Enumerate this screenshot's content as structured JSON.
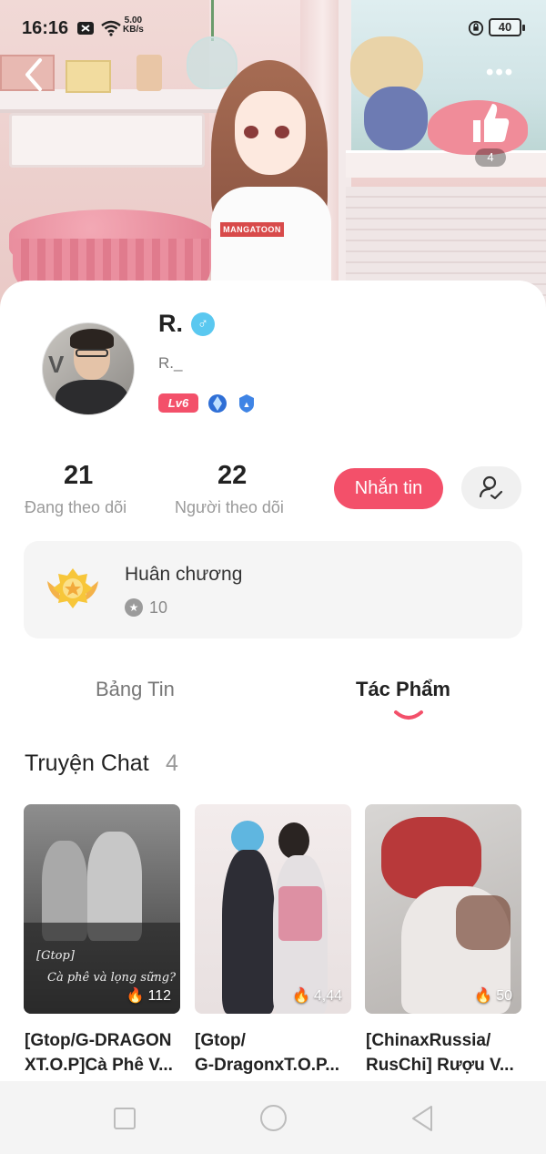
{
  "status_bar": {
    "time": "16:16",
    "net_speed": "5.00",
    "net_unit": "KB/s",
    "battery": "40"
  },
  "header": {
    "like_count": "4"
  },
  "profile": {
    "name": "R.",
    "gender_symbol": "♂",
    "handle": "R._",
    "level": "Lv6"
  },
  "stats": {
    "following_count": "21",
    "following_label": "Đang theo dõi",
    "followers_count": "22",
    "followers_label": "Người theo dõi",
    "message_button": "Nhắn tin"
  },
  "medal": {
    "title": "Huân chương",
    "count": "10"
  },
  "tabs": {
    "feed": "Bảng Tin",
    "works": "Tác Phẩm",
    "active": "works"
  },
  "section": {
    "title": "Truyện Chat",
    "count": "4"
  },
  "works": [
    {
      "cover_caption": "[Gtop]",
      "cover_caption2": "Cà phê và lọng sững?",
      "count": "112",
      "title_line1": "[Gtop/G-DRAGON",
      "title_line2": "XT.O.P]Cà Phê V..."
    },
    {
      "count": "4,44",
      "title_line1": "[Gtop/",
      "title_line2": "G-DragonxT.O.P..."
    },
    {
      "count": "50",
      "title_line1": "[ChinaxRussia/",
      "title_line2": "RusChi] Rượu V..."
    }
  ],
  "colors": {
    "accent": "#f3506a",
    "gender_badge": "#5ac8f0"
  },
  "icons": [
    "back-arrow-icon",
    "more-dots-icon",
    "thumbs-up-icon",
    "gender-male-icon",
    "level-badge-icon",
    "diamond-badge-icon",
    "shield-badge-icon",
    "follow-user-icon",
    "medal-icon",
    "star-icon",
    "flame-icon",
    "nav-recents-icon",
    "nav-home-icon",
    "nav-back-icon"
  ]
}
